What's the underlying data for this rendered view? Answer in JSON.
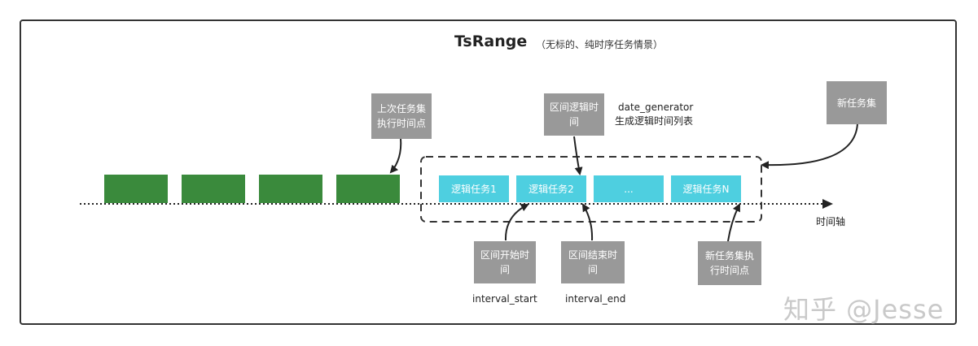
{
  "title": "TsRange",
  "subtitle": "（无标的、纯时序任务情景）",
  "past_tasks": [
    "",
    "",
    "",
    ""
  ],
  "logic_tasks": [
    "逻辑任务1",
    "逻辑任务2",
    "...",
    "逻辑任务N"
  ],
  "callouts": {
    "last_exec": "上次任务集执行时间点",
    "interval_logic": "区间逻辑时间",
    "date_generator": "date_generator",
    "date_generator_desc": "生成逻辑时间列表",
    "new_taskset": "新任务集",
    "interval_start": "区间开始时间",
    "interval_start_code": "interval_start",
    "interval_end": "区间结束时间",
    "interval_end_code": "interval_end",
    "new_exec": "新任务集执行时间点"
  },
  "axis_label": "时间轴",
  "watermark": "知乎 @Jesse",
  "colors": {
    "past": "#3a8a3c",
    "logic": "#4ecfe0",
    "callout": "#999999"
  }
}
